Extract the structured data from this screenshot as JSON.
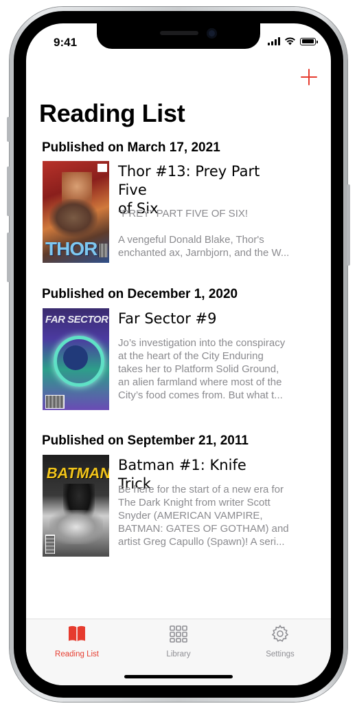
{
  "status_bar": {
    "time": "9:41"
  },
  "header": {
    "title": "Reading List"
  },
  "sections": [
    {
      "header": "Published on March 17, 2021",
      "item": {
        "title_line1": "Thor #13: Prey Part Five",
        "title_line2": "of Six",
        "desc_line1": "\"PREY\" PART FIVE OF SIX!",
        "desc_line2": "",
        "desc_line3": "A vengeful Donald Blake, Thor's",
        "desc_line4": "enchanted ax, Jarnbjorn, and the W...",
        "cover_text": "THOR"
      }
    },
    {
      "header": "Published on December 1, 2020",
      "item": {
        "title_line1": "Far Sector #9",
        "desc_line1": "Jo’s investigation into the conspiracy",
        "desc_line2": "at the heart of the City Enduring",
        "desc_line3": "takes her to Platform Solid Ground,",
        "desc_line4": "an alien farmland where most of the",
        "desc_line5": "City’s food comes from. But what t...",
        "cover_text": "FAR SECTOR"
      }
    },
    {
      "header": "Published on September 21, 2011",
      "item": {
        "title_line1": "Batman #1: Knife Trick",
        "desc_line1": "Be here for the start of a new era for",
        "desc_line2": "The Dark Knight from writer Scott",
        "desc_line3": "Snyder (AMERICAN VAMPIRE,",
        "desc_line4": "BATMAN: GATES OF GOTHAM) and",
        "desc_line5": "artist Greg Capullo (Spawn)! A seri...",
        "cover_text": "BATMAN"
      }
    }
  ],
  "tab_bar": {
    "tabs": [
      {
        "label": "Reading List",
        "icon": "book-icon",
        "active": true
      },
      {
        "label": "Library",
        "icon": "grid-icon",
        "active": false
      },
      {
        "label": "Settings",
        "icon": "gear-icon",
        "active": false
      }
    ]
  },
  "colors": {
    "accent": "#e63b2e",
    "inactive": "#8e8e93",
    "secondary_text": "#8a8a8e"
  }
}
